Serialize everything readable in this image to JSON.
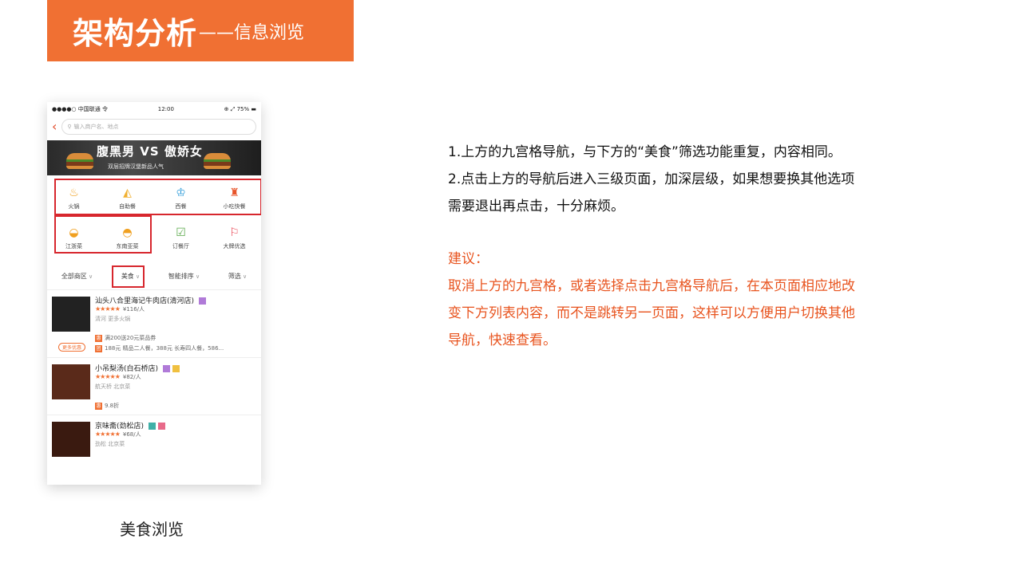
{
  "title": {
    "main": "架构分析",
    "sub": "——信息浏览"
  },
  "phone": {
    "status": {
      "left": "●●●●○ 中国联通 令",
      "time": "12:00",
      "right": "⊕ ⤢ 75% ▬"
    },
    "search_placeholder": "输入商户名、地点",
    "ad": {
      "headline": "腹黑男 VS 傲娇女",
      "subline": "双层招牌汉堡新品人气"
    },
    "categories": [
      {
        "label": "火锅",
        "icon": "hotpot-icon",
        "glyph": "♨",
        "color": "#f0a020"
      },
      {
        "label": "自助餐",
        "icon": "cake-icon",
        "glyph": "◭",
        "color": "#f0b030"
      },
      {
        "label": "西餐",
        "icon": "chef-hat-icon",
        "glyph": "♔",
        "color": "#2a9ad8"
      },
      {
        "label": "小吃快餐",
        "icon": "fries-icon",
        "glyph": "♜",
        "color": "#e8542a"
      },
      {
        "label": "江浙菜",
        "icon": "burger-icon",
        "glyph": "◒",
        "color": "#f0a020"
      },
      {
        "label": "东南亚菜",
        "icon": "dish-icon",
        "glyph": "◓",
        "color": "#f0a020"
      },
      {
        "label": "订餐厅",
        "icon": "calendar-check-icon",
        "glyph": "☑",
        "color": "#5aa84a"
      },
      {
        "label": "大牌优选",
        "icon": "ribbon-icon",
        "glyph": "⚐",
        "color": "#e83a4a"
      }
    ],
    "filters": [
      "全部商区",
      "美食",
      "智能排序",
      "筛选"
    ],
    "restaurants": [
      {
        "name": "汕头八合里海记牛肉店(清河店)",
        "price": "¥116/人",
        "meta": "清河  更多火锅",
        "promos": [
          "满200送20元菜品券",
          "188元 精品二人餐，388元 长寿四人餐，586..."
        ],
        "badge": "更多优惠"
      },
      {
        "name": "小吊梨汤(白石桥店)",
        "price": "¥82/人",
        "meta": "航天桥  北京菜",
        "promos": [
          "9.8折"
        ]
      },
      {
        "name": "京味斋(劲松店)",
        "price": "¥68/人",
        "meta": "劲松  北京菜"
      }
    ]
  },
  "caption": "美食浏览",
  "notes": {
    "p1": "1.上方的九宫格导航，与下方的“美食”筛选功能重复，内容相同。",
    "p2": "2.点击上方的导航后进入三级页面，加深层级，如果想要换其他选项需要退出再点击，十分麻烦。",
    "suggest_title": "建议：",
    "suggest_body": "取消上方的九宫格，或者选择点击九宫格导航后，在本页面相应地改变下方列表内容，而不是跳转另一页面，这样可以方便用户切换其他导航，快速查看。"
  },
  "colors": {
    "accent": "#f07033",
    "highlight": "#d7262d",
    "suggest": "#e8541f"
  }
}
